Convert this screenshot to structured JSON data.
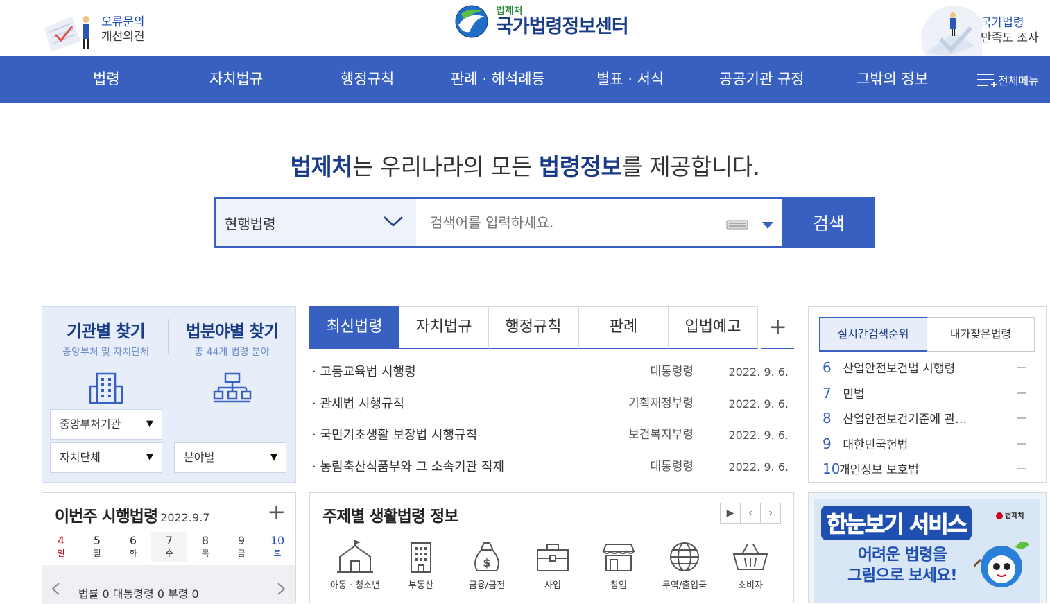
{
  "header": {
    "feedback": {
      "line1": "오류문의",
      "line2": "개선의견"
    },
    "logo": {
      "small": "법제처",
      "big": "국가법령정보센터"
    },
    "survey": {
      "line1": "국가법령",
      "line2": "만족도 조사"
    }
  },
  "nav": {
    "items": [
      "법령",
      "자치법규",
      "행정규칙",
      "판례 · 해석례등",
      "별표 · 서식",
      "공공기관 규정",
      "그밖의 정보"
    ],
    "all_menu": "전체메뉴"
  },
  "hero": {
    "pre": "법제처",
    "mid1": "는 우리나라의 모든 ",
    "strong": "법령정보",
    "post": "를 제공합니다."
  },
  "search": {
    "scope": "현행법령",
    "placeholder": "검색어를 입력하세요.",
    "button": "검색"
  },
  "finder": {
    "org": {
      "title": "기관별 찾기",
      "sub": "중앙부처 및 자치단체",
      "select1": "중앙부처기관",
      "select2": "자치단체"
    },
    "field": {
      "title": "법분야별 찾기",
      "sub": "총 44개 법령 분야",
      "select1": "분야별"
    }
  },
  "tabs": {
    "items": [
      "최신법령",
      "자치법규",
      "행정규칙",
      "판례",
      "입법예고"
    ],
    "active": 0,
    "more": "+"
  },
  "laws": [
    {
      "name": "고등교육법 시행령",
      "dept": "대통령령",
      "date": "2022. 9. 6."
    },
    {
      "name": "관세법 시행규칙",
      "dept": "기획재정부령",
      "date": "2022. 9. 6."
    },
    {
      "name": "국민기초생활 보장법 시행규칙",
      "dept": "보건복지부령",
      "date": "2022. 9. 6."
    },
    {
      "name": "농림축산식품부와 그 소속기관 직제",
      "dept": "대통령령",
      "date": "2022. 9. 6."
    }
  ],
  "rank": {
    "tabs": [
      "실시간검색순위",
      "내가찾은법령"
    ],
    "items": [
      {
        "num": "6",
        "name": "산업안전보건법 시행령"
      },
      {
        "num": "7",
        "name": "민법"
      },
      {
        "num": "8",
        "name": "산업안전보건기준에 관…"
      },
      {
        "num": "9",
        "name": "대한민국헌법"
      },
      {
        "num": "10",
        "name": "개인정보 보호법"
      }
    ]
  },
  "week": {
    "title": "이번주 시행법령",
    "date": "2022.9.7",
    "more": "+",
    "days": [
      {
        "n": "4",
        "w": "일"
      },
      {
        "n": "5",
        "w": "월"
      },
      {
        "n": "6",
        "w": "화"
      },
      {
        "n": "7",
        "w": "수"
      },
      {
        "n": "8",
        "w": "목"
      },
      {
        "n": "9",
        "w": "금"
      },
      {
        "n": "10",
        "w": "토"
      }
    ],
    "bottom": "법률 0   대통령령 0   부령 0"
  },
  "topics": {
    "title": "주제별 생활법령 정보",
    "items": [
      "아동 · 청소년",
      "부동산",
      "금융/금전",
      "사업",
      "창업",
      "무역/출입국",
      "소비자"
    ]
  },
  "banner": {
    "title": "한눈보기 서비스",
    "logo": "법제처",
    "line1": "어려운 법령을",
    "line2": "그림으로 보세요!"
  },
  "colors": {
    "primary": "#3760c0",
    "navy": "#1a3c88",
    "light": "#e7eef9"
  }
}
